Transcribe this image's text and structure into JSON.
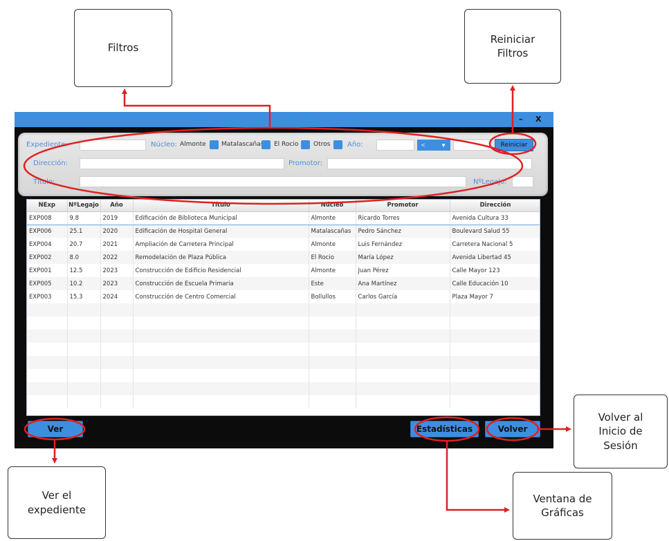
{
  "annotations": {
    "filtros": "Filtros",
    "reiniciar_filtros": "Reiniciar\nFiltros",
    "volver_inicio": "Volver al\nInicio de\nSesión",
    "ver_expediente": "Ver el\nexpediente",
    "ventana_graficas": "Ventana de\nGráficas"
  },
  "window": {
    "minimize": "–",
    "close": "X"
  },
  "filters": {
    "expediente_label": "Expediente:",
    "nucleo_label": "Núcleo:",
    "nucleo_options": [
      "Almonte",
      "Matalascañas",
      "El Rocio",
      "Otros"
    ],
    "anio_label": "Año:",
    "anio_operator": "<",
    "reset_button": "Reiniciar",
    "direccion_label": "Dirección:",
    "promotor_label": "Promotor:",
    "titulo_label": "Título:",
    "legajo_label": "NºLegajo:"
  },
  "table": {
    "columns": [
      "NExp",
      "NºLegajo",
      "Año",
      "Título",
      "Núcleo",
      "Promotor",
      "Dirección"
    ],
    "rows": [
      [
        "EXP008",
        "9.8",
        "2019",
        "Edificación de Biblioteca Municipal",
        "Almonte",
        "Ricardo Torres",
        "Avenida Cultura 33"
      ],
      [
        "EXP006",
        "25.1",
        "2020",
        "Edificación de Hospital General",
        "Matalascañas",
        "Pedro Sánchez",
        "Boulevard Salud 55"
      ],
      [
        "EXP004",
        "20.7",
        "2021",
        "Ampliación de Carretera Principal",
        "Almonte",
        "Luis Fernández",
        "Carretera Nacional 5"
      ],
      [
        "EXP002",
        "8.0",
        "2022",
        "Remodelación de Plaza Pública",
        "El Rocio",
        "María López",
        "Avenida Libertad 45"
      ],
      [
        "EXP001",
        "12.5",
        "2023",
        "Construcción de Edificio Residencial",
        "Almonte",
        "Juan Pérez",
        "Calle Mayor 123"
      ],
      [
        "EXP005",
        "10.2",
        "2023",
        "Construcción de Escuela Primaria",
        "Este",
        "Ana Martínez",
        "Calle Educación 10"
      ],
      [
        "EXP003",
        "15.3",
        "2024",
        "Construcción de Centro Comercial",
        "Bollullos",
        "Carlos García",
        "Plaza Mayor 7"
      ]
    ],
    "empty_rows": 8
  },
  "buttons": {
    "ver": "Ver",
    "estadisticas": "Estadísticas",
    "volver": "Volver"
  },
  "colors": {
    "accent": "#3e8ee0",
    "annotation": "#e02020",
    "window_bg": "#0c0c0c"
  }
}
